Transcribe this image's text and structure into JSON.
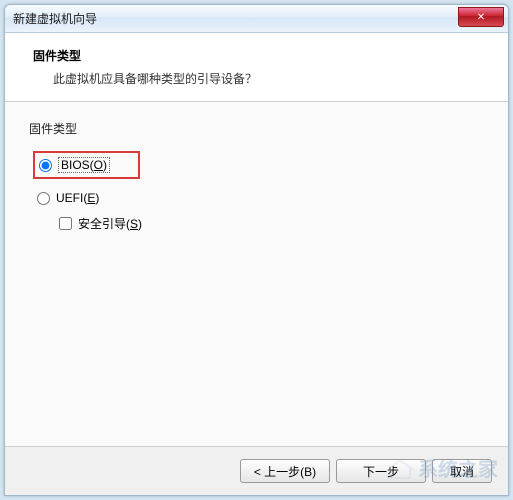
{
  "window": {
    "title": "新建虚拟机向导"
  },
  "header": {
    "title": "固件类型",
    "subtitle": "此虚拟机应具备哪种类型的引导设备？"
  },
  "group": {
    "label": "固件类型"
  },
  "options": {
    "bios": {
      "label": "BIOS(",
      "key": "O",
      "after": ")",
      "checked": true
    },
    "uefi": {
      "label": "UEFI(",
      "key": "E",
      "after": ")",
      "checked": false
    },
    "secureBoot": {
      "label": "安全引导(",
      "key": "S",
      "after": ")",
      "checked": false
    }
  },
  "buttons": {
    "back": "< 上一步(B)",
    "next": "下一步",
    "cancel": "取消"
  },
  "watermark": {
    "text": "系统之家"
  }
}
